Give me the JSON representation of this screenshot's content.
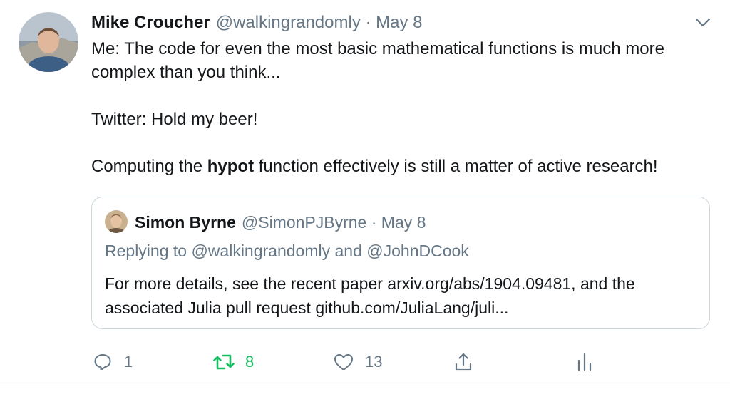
{
  "tweet": {
    "author_name": "Mike Croucher",
    "handle_time": "@walkingrandomly · May 8",
    "line1": "Me: The code for even the most basic mathematical functions is much more complex than you think...",
    "line2": "Twitter: Hold my beer!",
    "line3_before": "Computing the ",
    "line3_bold": "hypot",
    "line3_after": " function effectively is still a matter of active research!"
  },
  "quoted": {
    "author_name": "Simon Byrne",
    "handle_time": "@SimonPJByrne · May 8",
    "replying": "Replying to @walkingrandomly and @JohnDCook",
    "text": "For more details, see the recent paper arxiv.org/abs/1904.09481, and the associated Julia pull request github.com/JuliaLang/juli..."
  },
  "actions": {
    "reply_count": "1",
    "retweet_count": "8",
    "like_count": "13"
  },
  "colors": {
    "text": "#14171a",
    "secondary": "#657786",
    "retweet_active": "#17bf63",
    "border": "#ccd6dd"
  },
  "icons": [
    "avatar-mike-croucher",
    "chevron-down-icon",
    "avatar-simon-byrne",
    "reply-icon",
    "retweet-icon",
    "like-icon",
    "share-icon",
    "analytics-icon"
  ]
}
